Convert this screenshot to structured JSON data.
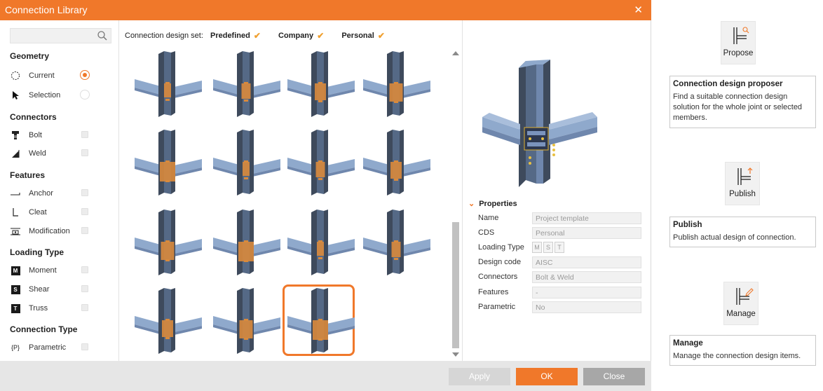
{
  "window": {
    "title": "Connection Library",
    "close_glyph": "✕"
  },
  "search": {
    "placeholder": "",
    "icon": "search-icon"
  },
  "left": {
    "geometry": {
      "title": "Geometry",
      "current": "Current",
      "selection": "Selection",
      "selected": "Current"
    },
    "connectors": {
      "title": "Connectors",
      "bolt": "Bolt",
      "weld": "Weld"
    },
    "features": {
      "title": "Features",
      "anchor": "Anchor",
      "cleat": "Cleat",
      "modification": "Modification"
    },
    "loading": {
      "title": "Loading Type",
      "moment": "Moment",
      "shear": "Shear",
      "truss": "Truss",
      "moment_badge": "M",
      "shear_badge": "S",
      "truss_badge": "T"
    },
    "conn_type": {
      "title": "Connection Type",
      "parametric": "Parametric",
      "param_glyph": "{P}"
    }
  },
  "cds": {
    "label": "Connection design set:",
    "options": [
      "Predefined",
      "Company",
      "Personal"
    ],
    "check": "✔"
  },
  "grid": {
    "tile_count": 15,
    "selected_index": 14
  },
  "properties": {
    "title": "Properties",
    "chev": "⌄",
    "rows": [
      {
        "key": "Name",
        "value": "Project template"
      },
      {
        "key": "CDS",
        "value": "Personal"
      },
      {
        "key": "Loading Type",
        "toggles": [
          "M",
          "S",
          "T"
        ]
      },
      {
        "key": "Design code",
        "value": "AISC"
      },
      {
        "key": "Connectors",
        "value": "Bolt & Weld"
      },
      {
        "key": "Features",
        "value": "-"
      },
      {
        "key": "Parametric",
        "value": "No"
      }
    ]
  },
  "footer": {
    "apply": "Apply",
    "ok": "OK",
    "close": "Close"
  },
  "help": {
    "propose": {
      "button": "Propose",
      "title": "Connection design proposer",
      "desc": "Find a suitable connection design solution for the whole joint or selected members."
    },
    "publish": {
      "button": "Publish",
      "title": "Publish",
      "desc": "Publish actual design of connection."
    },
    "manage": {
      "button": "Manage",
      "title": "Manage",
      "desc": "Manage the connection design items."
    }
  },
  "colors": {
    "accent": "#f0782a",
    "steel_dark": "#3e4a5c",
    "steel_light": "#8fa9cc",
    "plate": "#d98a3c"
  }
}
